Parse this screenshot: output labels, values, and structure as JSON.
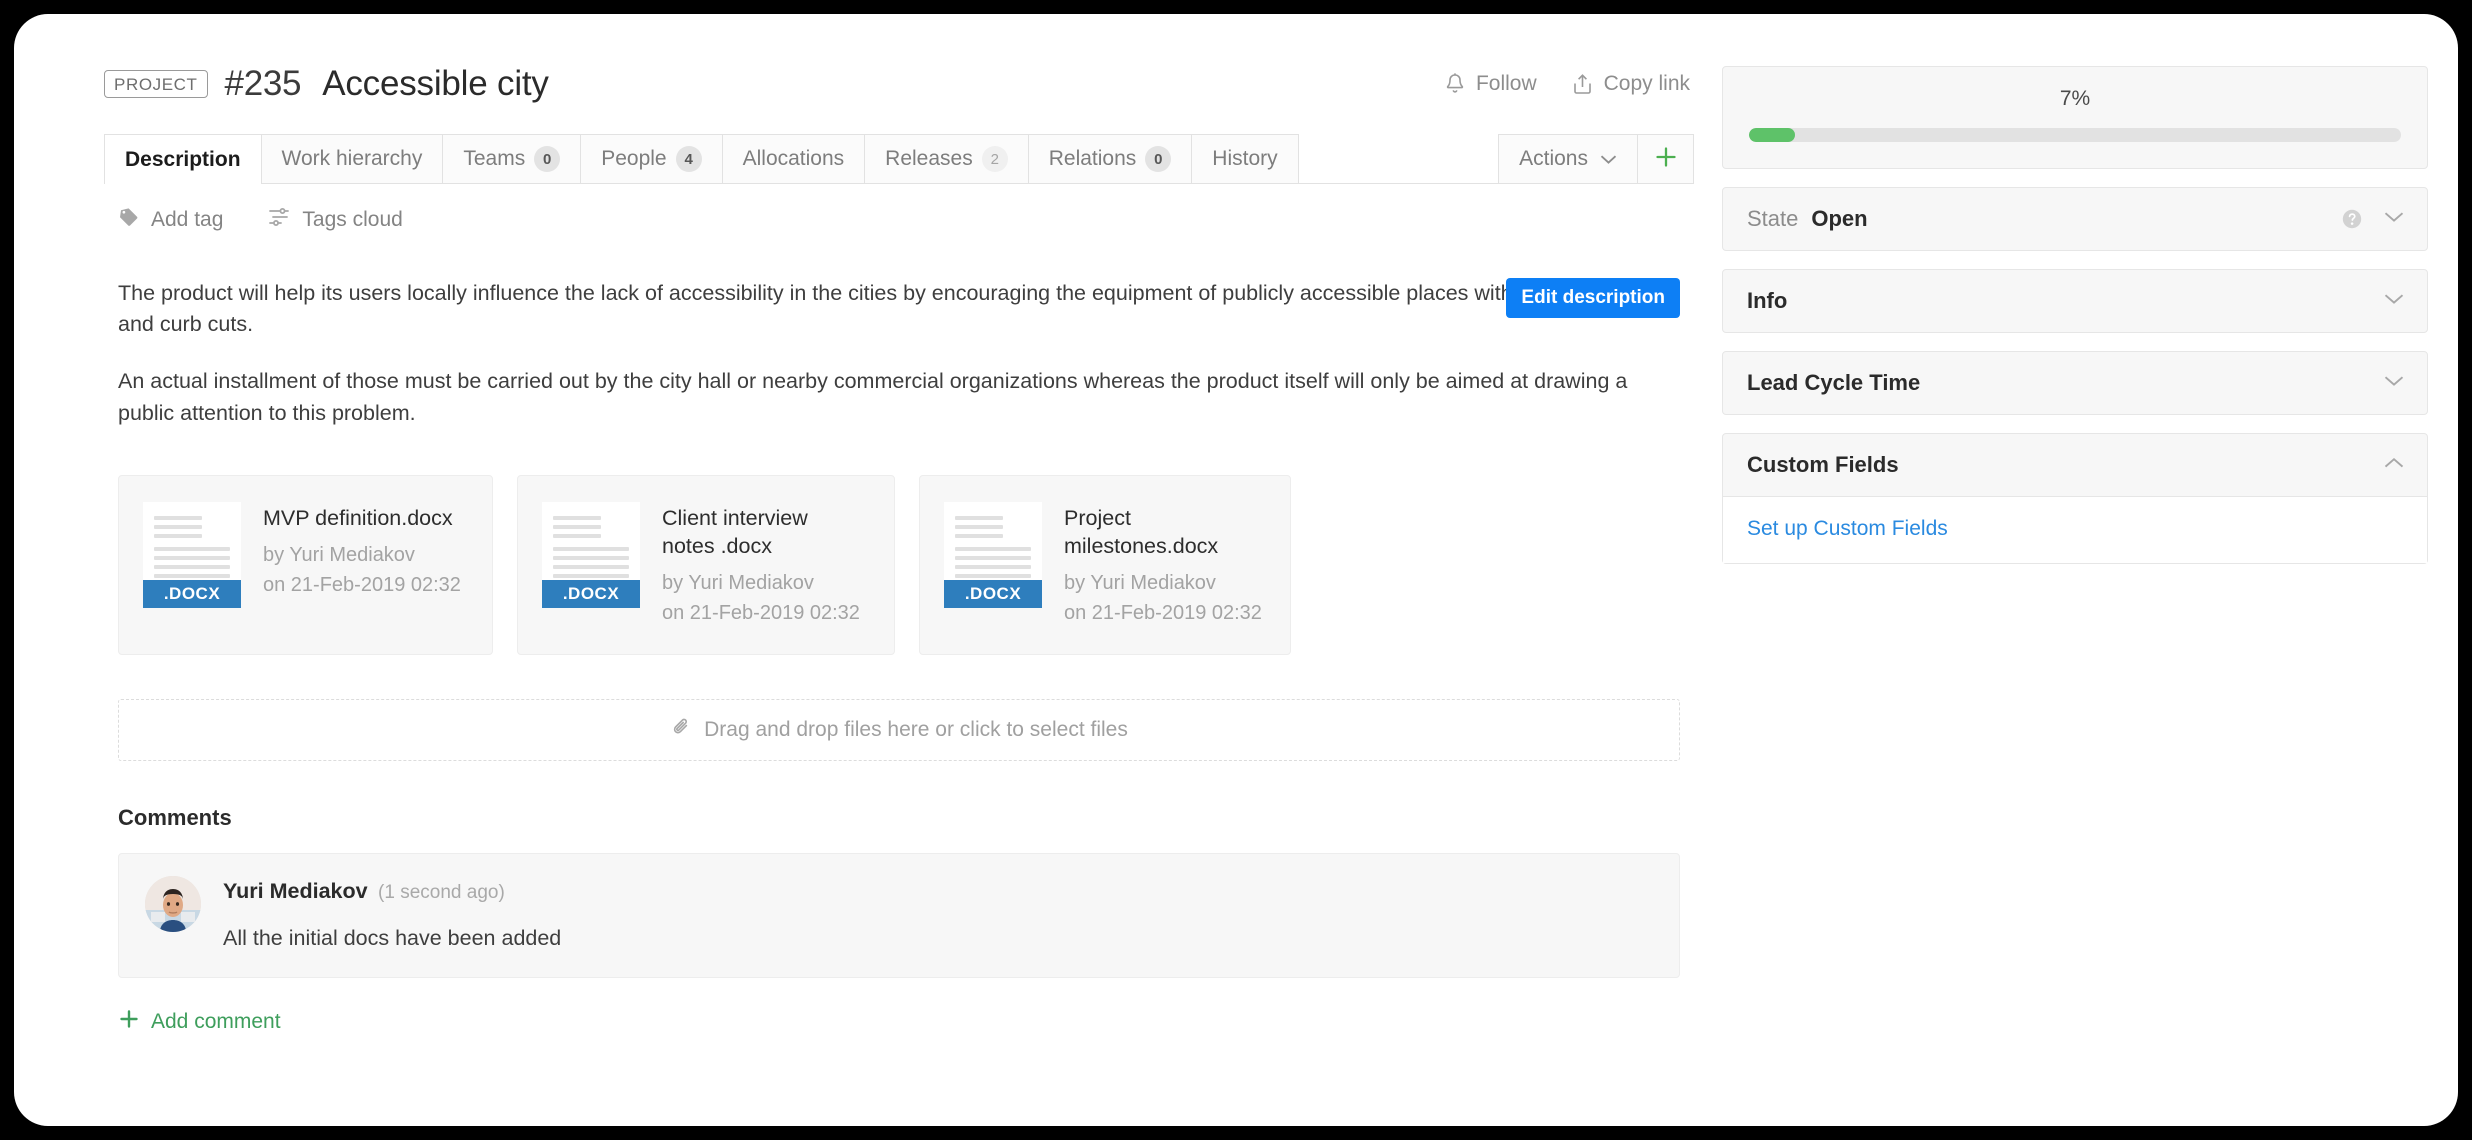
{
  "header": {
    "type_badge": "PROJECT",
    "issue_id": "#235",
    "subject": "Accessible city",
    "follow_label": "Follow",
    "copy_link_label": "Copy link"
  },
  "tabs": [
    {
      "label": "Description",
      "count": null,
      "active": true
    },
    {
      "label": "Work hierarchy",
      "count": null,
      "active": false
    },
    {
      "label": "Teams",
      "count": "0",
      "active": false
    },
    {
      "label": "People",
      "count": "4",
      "active": false
    },
    {
      "label": "Allocations",
      "count": null,
      "active": false
    },
    {
      "label": "Releases",
      "count": "2",
      "active": false
    },
    {
      "label": "Relations",
      "count": "0",
      "active": false
    },
    {
      "label": "History",
      "count": null,
      "active": false
    }
  ],
  "tab_actions": {
    "actions_label": "Actions",
    "plus_icon": "plus-icon",
    "chevron_icon": "chevron-down-icon"
  },
  "tags_row": {
    "add_tag_label": "Add tag",
    "add_tag_icon": "tag-icon",
    "tags_cloud_label": "Tags cloud",
    "tags_cloud_icon": "sliders-icon"
  },
  "description": {
    "edit_button_label": "Edit description",
    "paragraphs": [
      "The product will help its users locally influence the lack of accessibility in the cities by encouraging the equipment of publicly accessible places with ramps, lifts, and curb cuts.",
      "An actual installment of those must be carried out by the city hall or nearby commercial organizations whereas the product itself will only be aimed at drawing a public attention to this problem."
    ]
  },
  "attachments": [
    {
      "name": "MVP definition.docx",
      "ext_label": ".DOCX",
      "by": "by Yuri Mediakov",
      "on": "on 21-Feb-2019 02:32"
    },
    {
      "name": "Client interview notes .docx",
      "ext_label": ".DOCX",
      "by": "by Yuri Mediakov",
      "on": "on 21-Feb-2019 02:32"
    },
    {
      "name": "Project milestones.docx",
      "ext_label": ".DOCX",
      "by": "by Yuri Mediakov",
      "on": "on 21-Feb-2019 02:32"
    }
  ],
  "dropzone": {
    "label": "Drag and drop files here or click to select files",
    "icon": "paperclip-icon"
  },
  "comments": {
    "heading": "Comments",
    "items": [
      {
        "author": "Yuri Mediakov",
        "time": "(1 second ago)",
        "text": "All the initial docs have been added"
      }
    ],
    "add_label": "Add comment",
    "add_icon": "plus-icon"
  },
  "sidebar": {
    "progress": {
      "percent_label": "7%",
      "percent_value": 7,
      "fill_color": "#5ec269",
      "track_color": "#e2e2e2"
    },
    "state_panel": {
      "label": "State",
      "value": "Open",
      "help_icon": "question-circle-icon",
      "chevron_icon": "chevron-down-icon"
    },
    "panels": [
      {
        "title": "Info",
        "expanded": false,
        "chevron_icon": "chevron-down-icon"
      },
      {
        "title": "Lead Cycle Time",
        "expanded": false,
        "chevron_icon": "chevron-down-icon"
      },
      {
        "title": "Custom Fields",
        "expanded": true,
        "chevron_icon": "chevron-up-icon"
      }
    ],
    "custom_fields_link": "Set up Custom Fields"
  },
  "colors": {
    "accent_blue": "#0d7ff5",
    "link_blue": "#2a8ae0",
    "green": "#3e9e5c",
    "docx_blue": "#2e7ebd"
  }
}
